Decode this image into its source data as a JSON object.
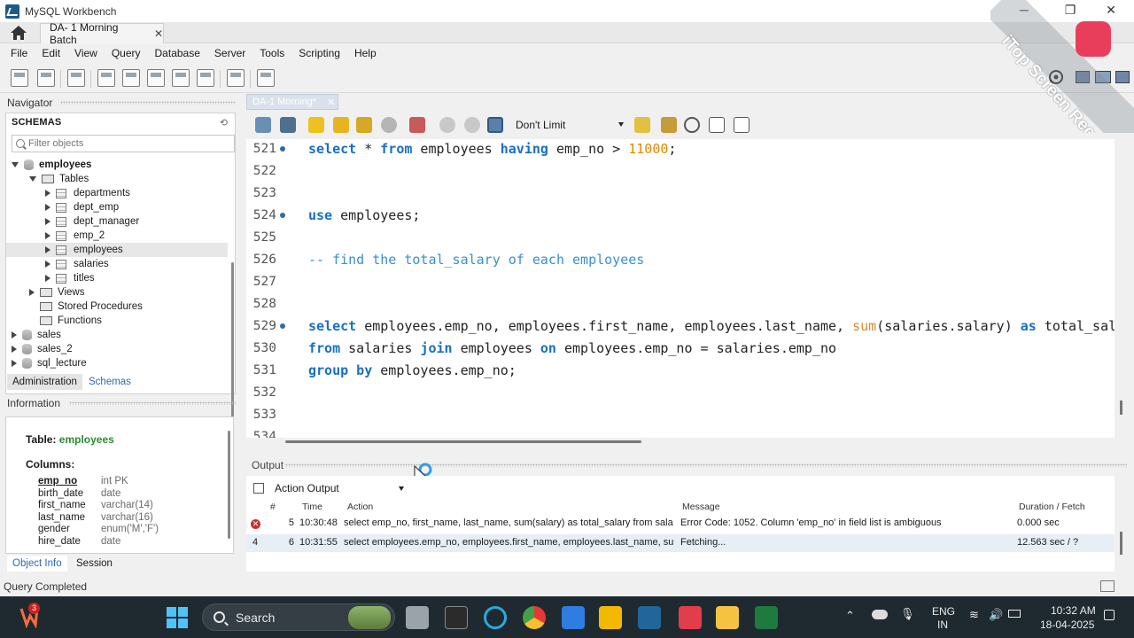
{
  "window": {
    "title": "MySQL Workbench",
    "minimize": "─",
    "restore": "❐",
    "close": "✕"
  },
  "tabs": {
    "connection_tab": "DA- 1 Morning Batch",
    "close": "✕"
  },
  "menu": [
    "File",
    "Edit",
    "View",
    "Query",
    "Database",
    "Server",
    "Tools",
    "Scripting",
    "Help"
  ],
  "navigator": {
    "header": "Navigator",
    "schemas_title": "SCHEMAS",
    "filter_placeholder": "Filter objects",
    "tree": [
      {
        "label": "employees",
        "level": 0,
        "type": "db",
        "expanded": true,
        "bold": true
      },
      {
        "label": "Tables",
        "level": 1,
        "type": "folder",
        "expanded": true
      },
      {
        "label": "departments",
        "level": 2,
        "type": "table"
      },
      {
        "label": "dept_emp",
        "level": 2,
        "type": "table"
      },
      {
        "label": "dept_manager",
        "level": 2,
        "type": "table"
      },
      {
        "label": "emp_2",
        "level": 2,
        "type": "table"
      },
      {
        "label": "employees",
        "level": 2,
        "type": "table",
        "selected": true
      },
      {
        "label": "salaries",
        "level": 2,
        "type": "table"
      },
      {
        "label": "titles",
        "level": 2,
        "type": "table"
      },
      {
        "label": "Views",
        "level": 1,
        "type": "folder"
      },
      {
        "label": "Stored Procedures",
        "level": 1,
        "type": "folder",
        "noarrow": true
      },
      {
        "label": "Functions",
        "level": 1,
        "type": "folder",
        "noarrow": true
      },
      {
        "label": "sales",
        "level": 0,
        "type": "db"
      },
      {
        "label": "sales_2",
        "level": 0,
        "type": "db"
      },
      {
        "label": "sql_lecture",
        "level": 0,
        "type": "db"
      }
    ],
    "subtabs": [
      "Administration",
      "Schemas"
    ],
    "info_header": "Information",
    "table_label": "Table:",
    "table_name": "employees",
    "columns_label": "Columns:",
    "columns": [
      {
        "name": "emp_no",
        "type": "int PK"
      },
      {
        "name": "birth_date",
        "type": "date"
      },
      {
        "name": "first_name",
        "type": "varchar(14)"
      },
      {
        "name": "last_name",
        "type": "varchar(16)"
      },
      {
        "name": "gender",
        "type": "enum('M','F')"
      },
      {
        "name": "hire_date",
        "type": "date"
      }
    ],
    "bottom_tabs": [
      "Object Info",
      "Session"
    ]
  },
  "editor": {
    "tab_label": "DA-1 Morning*",
    "tab_close": "✕",
    "limit_value": "Don't Limit",
    "lines": [
      {
        "no": "521",
        "dot": true,
        "code": [
          {
            "t": "select",
            "c": "kw"
          },
          {
            "t": " * "
          },
          {
            "t": "from",
            "c": "kw"
          },
          {
            "t": " employees "
          },
          {
            "t": "having",
            "c": "kw"
          },
          {
            "t": " emp_no > "
          },
          {
            "t": "11000",
            "c": "num"
          },
          {
            "t": ";"
          }
        ]
      },
      {
        "no": "522",
        "code": []
      },
      {
        "no": "523",
        "code": []
      },
      {
        "no": "524",
        "dot": true,
        "code": [
          {
            "t": "use",
            "c": "kw"
          },
          {
            "t": " employees;"
          }
        ]
      },
      {
        "no": "525",
        "code": []
      },
      {
        "no": "526",
        "code": [
          {
            "t": "-- find the total_salary of each employees",
            "c": "cmt"
          }
        ]
      },
      {
        "no": "527",
        "code": []
      },
      {
        "no": "528",
        "code": []
      },
      {
        "no": "529",
        "dot": true,
        "code": [
          {
            "t": "select",
            "c": "kw"
          },
          {
            "t": " employees.emp_no, employees.first_name, employees.last_name, "
          },
          {
            "t": "sum",
            "c": "fn"
          },
          {
            "t": "(salaries.salary) "
          },
          {
            "t": "as",
            "c": "kw"
          },
          {
            "t": " total_sal"
          }
        ]
      },
      {
        "no": "530",
        "code": [
          {
            "t": "from",
            "c": "kw"
          },
          {
            "t": " salaries "
          },
          {
            "t": "join",
            "c": "kw"
          },
          {
            "t": " employees "
          },
          {
            "t": "on",
            "c": "kw"
          },
          {
            "t": " employees.emp_no = salaries.emp_no"
          }
        ]
      },
      {
        "no": "531",
        "code": [
          {
            "t": "group by",
            "c": "kw"
          },
          {
            "t": " employees.emp_no;"
          }
        ]
      },
      {
        "no": "532",
        "code": []
      },
      {
        "no": "533",
        "code": []
      },
      {
        "no": "534",
        "code": []
      }
    ]
  },
  "output": {
    "header": "Output",
    "selector": "Action Output",
    "columns": [
      "#",
      "Time",
      "Action",
      "Message",
      "Duration / Fetch"
    ],
    "rows": [
      {
        "status": "error",
        "status_text": "✕",
        "index": "5",
        "time": "10:30:48",
        "action": "select emp_no, first_name, last_name, sum(salary) as total_salary from salarie...",
        "message": "Error Code: 1052. Column 'emp_no' in field list is ambiguous",
        "duration": "0.000 sec"
      },
      {
        "status": "running",
        "status_text": "4",
        "index": "6",
        "time": "10:31:55",
        "action": "select employees.emp_no, employees.first_name, employees.last_name, sum...",
        "message": "Fetching...",
        "duration": "12.563 sec / ?"
      }
    ]
  },
  "status_bar": {
    "text": "Query Completed"
  },
  "taskbar": {
    "search_label": "Search",
    "badge_count": "3",
    "language_line1": "ENG",
    "language_line2": "IN",
    "time": "10:32 AM",
    "date": "18-04-2025"
  },
  "watermark": {
    "text": "iTop Screen Recorder"
  },
  "colors": {
    "keyword": "#1a6fbf",
    "number": "#e08a00",
    "comment": "#3b8fcc",
    "selected_table": "#2e8b2e",
    "error": "#cc2f2f"
  }
}
